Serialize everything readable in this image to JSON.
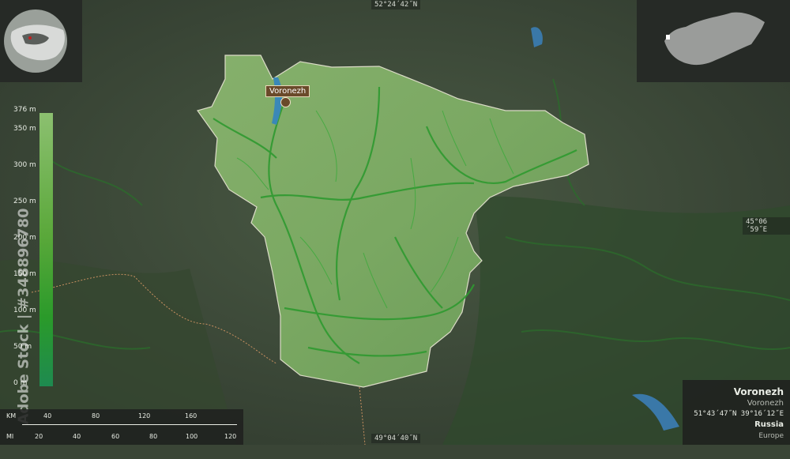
{
  "coords": {
    "top": "52°24´42˝N",
    "bottom": "49°04´40˝N",
    "right": "45°06´59˝E"
  },
  "city": {
    "label": "Voronezh"
  },
  "legend": {
    "ticks": [
      "376 m",
      "350 m",
      "300 m",
      "250 m",
      "200 m",
      "150 m",
      "100 m",
      "50 m",
      "0 m"
    ],
    "top_color": "#8cc070",
    "bottom_color": "#1e8a50"
  },
  "scale": {
    "km_unit": "KM",
    "km_ticks": [
      "40",
      "80",
      "120",
      "160"
    ],
    "mi_unit": "MI",
    "mi_ticks": [
      "20",
      "40",
      "60",
      "80",
      "100",
      "120"
    ]
  },
  "info": {
    "title": "Voronezh",
    "subtitle": "Voronezh",
    "coords": "51°43´47˝N 39°16´12˝E",
    "country": "Russia",
    "continent": "Europe"
  },
  "watermark": "Adobe Stock | #348896780"
}
